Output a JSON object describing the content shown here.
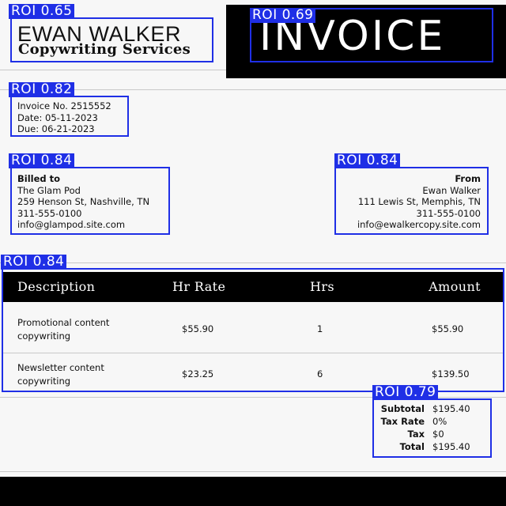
{
  "roi_tags": {
    "brand": "ROI 0.65",
    "title": "ROI 0.69",
    "meta": "ROI 0.82",
    "billed": "ROI 0.84",
    "from": "ROI 0.84",
    "table": "ROI 0.84",
    "totals": "ROI 0.79"
  },
  "header": {
    "company_name": "EWAN WALKER",
    "company_sub": "Copywriting Services",
    "title": "INVOICE"
  },
  "meta": {
    "invoice_no": "Invoice No. 2515552",
    "date": "Date: 05-11-2023",
    "due": "Due: 06-21-2023"
  },
  "billed_to": {
    "heading": "Billed to",
    "name": "The Glam Pod",
    "address": "259 Henson St, Nashville, TN",
    "phone": "311-555-0100",
    "email": "info@glampod.site.com"
  },
  "from": {
    "heading": "From",
    "name": "Ewan Walker",
    "address": "111 Lewis St, Memphis, TN",
    "phone": "311-555-0100",
    "email": "info@ewalkercopy.site.com"
  },
  "table": {
    "headers": [
      "Description",
      "Hr Rate",
      "Hrs",
      "Amount"
    ],
    "rows": [
      {
        "desc1": "Promotional content",
        "desc2": "copywriting",
        "rate": "$55.90",
        "hrs": "1",
        "amount": "$55.90"
      },
      {
        "desc1": "Newsletter content",
        "desc2": "copywriting",
        "rate": "$23.25",
        "hrs": "6",
        "amount": "$139.50"
      }
    ]
  },
  "totals": {
    "subtotal_label": "Subtotal",
    "subtotal": "$195.40",
    "tax_rate_label": "Tax Rate",
    "tax_rate": "0%",
    "tax_label": "Tax",
    "tax": "$0",
    "total_label": "Total",
    "total": "$195.40"
  },
  "colors": {
    "roi": "#1f2fe6",
    "band": "#000000",
    "background": "#f7f7f7"
  }
}
